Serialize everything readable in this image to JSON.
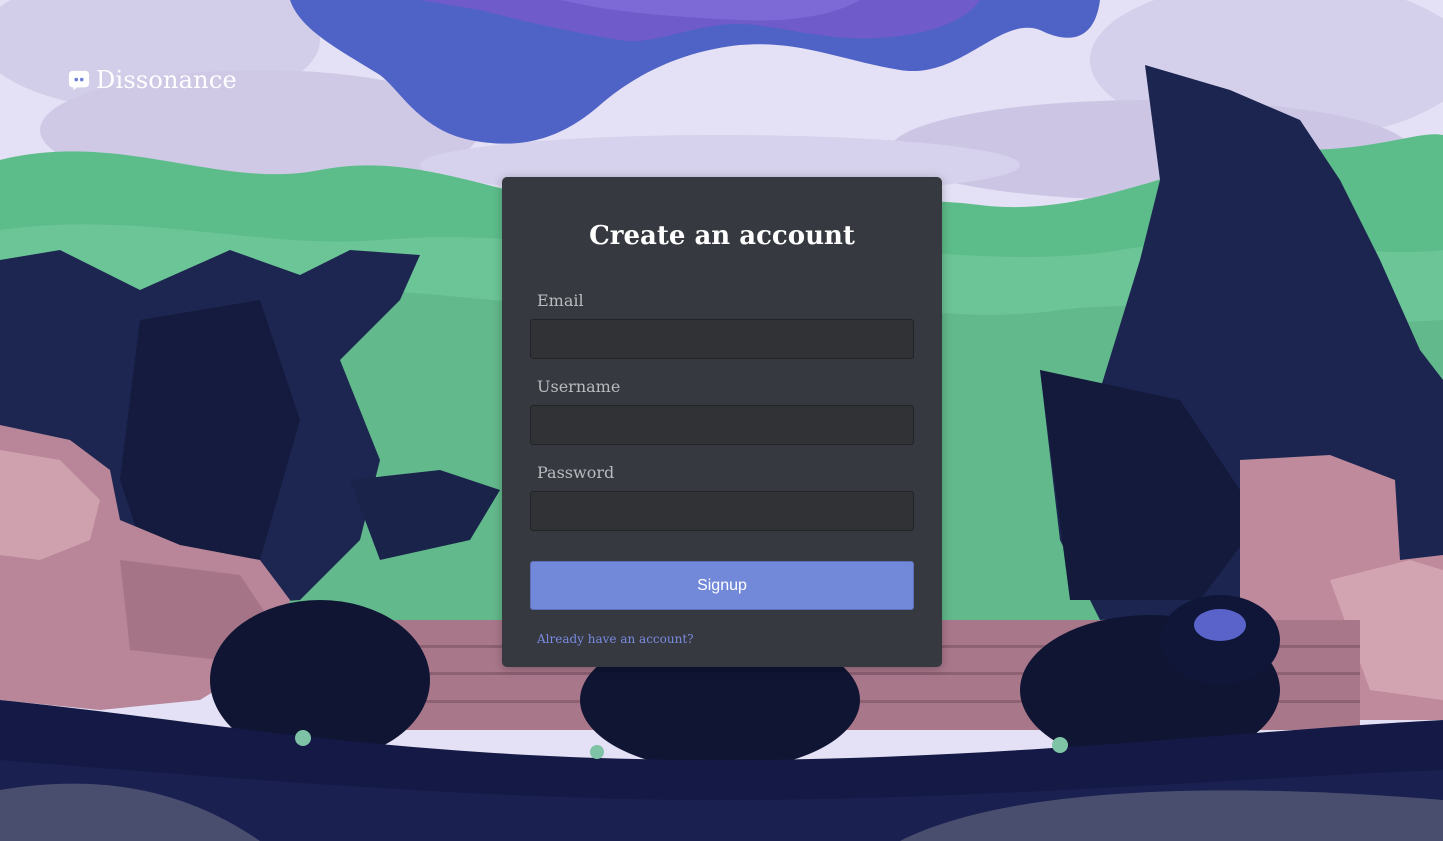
{
  "app": {
    "brand_name": "Dissonance",
    "brand_icon": "discord-logo-icon"
  },
  "signup_form": {
    "title": "Create an account",
    "email_label": "Email",
    "email_value": "",
    "username_label": "Username",
    "username_value": "",
    "password_label": "Password",
    "password_value": "",
    "submit_label": "Signup",
    "login_link": "Already have an account?"
  },
  "colors": {
    "card_background": "#36393f",
    "input_background": "#303236",
    "accent": "#7289da",
    "link": "#7a8be0",
    "label": "#b9bbbe"
  }
}
